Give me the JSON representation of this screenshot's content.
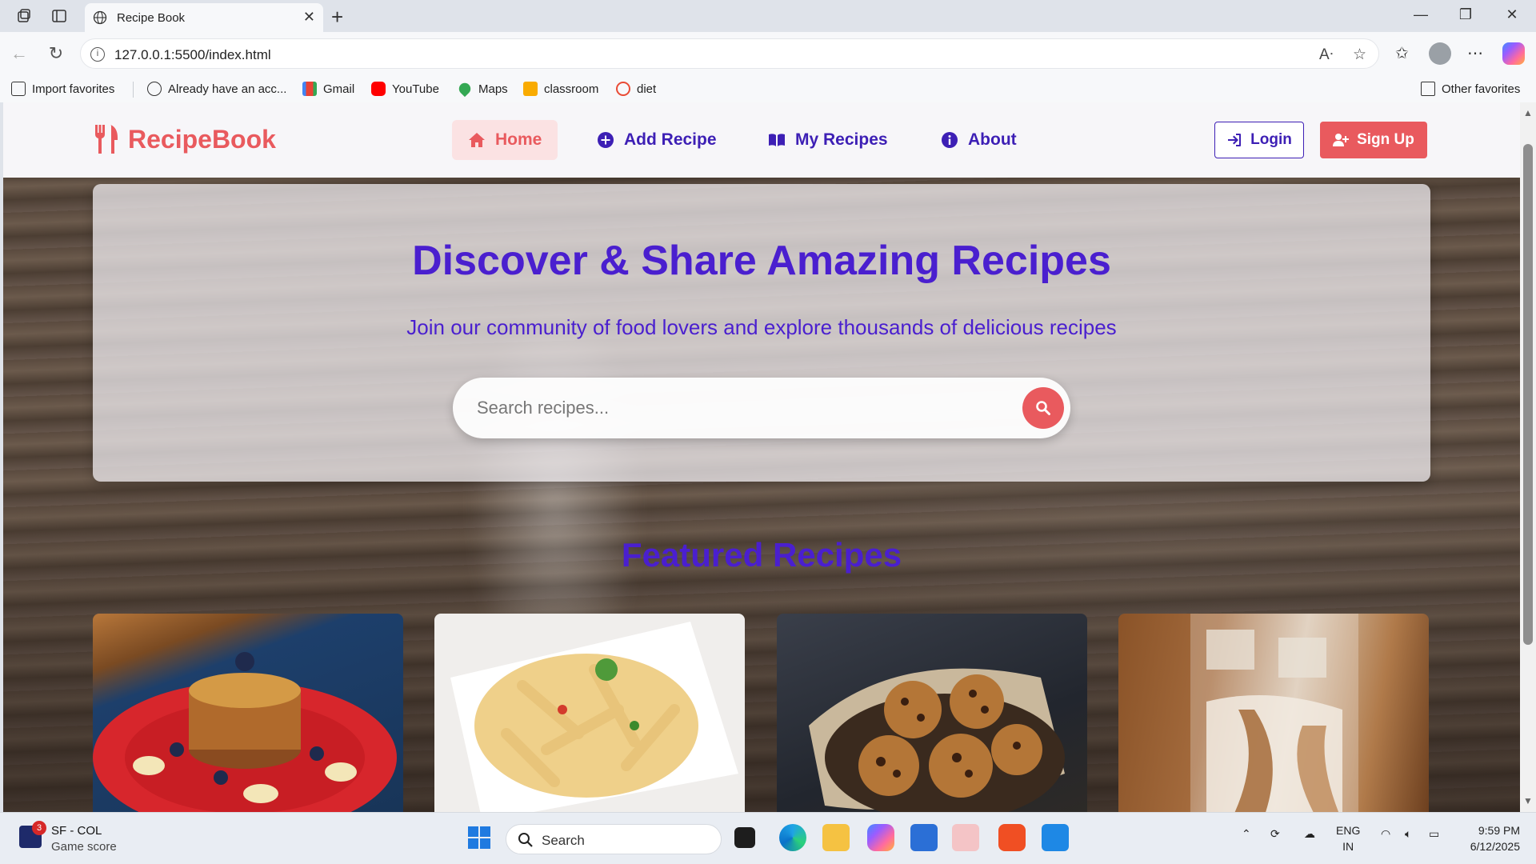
{
  "browser": {
    "tab_title": "Recipe Book",
    "url": "127.0.0.1:5500/index.html",
    "favorites": [
      {
        "label": "Import favorites",
        "icon": "import-icon"
      },
      {
        "label": "Already have an acc...",
        "icon": "globe-icon"
      },
      {
        "label": "Gmail",
        "icon": "gmail-icon"
      },
      {
        "label": "YouTube",
        "icon": "youtube-icon"
      },
      {
        "label": "Maps",
        "icon": "maps-icon"
      },
      {
        "label": "classroom",
        "icon": "classroom-icon"
      },
      {
        "label": "diet",
        "icon": "diet-icon"
      }
    ],
    "other_favorites": "Other favorites"
  },
  "site": {
    "logo": "RecipeBook",
    "nav": [
      {
        "label": "Home",
        "icon": "home-icon",
        "active": true
      },
      {
        "label": "Add Recipe",
        "icon": "plus-circle-icon",
        "active": false
      },
      {
        "label": "My Recipes",
        "icon": "book-icon",
        "active": false
      },
      {
        "label": "About",
        "icon": "info-icon",
        "active": false
      }
    ],
    "login": "Login",
    "signup": "Sign Up"
  },
  "hero": {
    "title": "Discover & Share Amazing Recipes",
    "subtitle": "Join our community of food lovers and explore thousands of delicious recipes",
    "search_placeholder": "Search recipes..."
  },
  "featured": {
    "heading": "Featured Recipes"
  },
  "taskbar": {
    "widget_title": "SF - COL",
    "widget_sub": "Game score",
    "widget_badge": "3",
    "search_label": "Search",
    "lang_1": "ENG",
    "lang_2": "IN",
    "time": "9:59 PM",
    "date": "6/12/2025"
  },
  "colors": {
    "brand_red": "#e95a5e",
    "brand_purple": "#4a1fcf"
  }
}
